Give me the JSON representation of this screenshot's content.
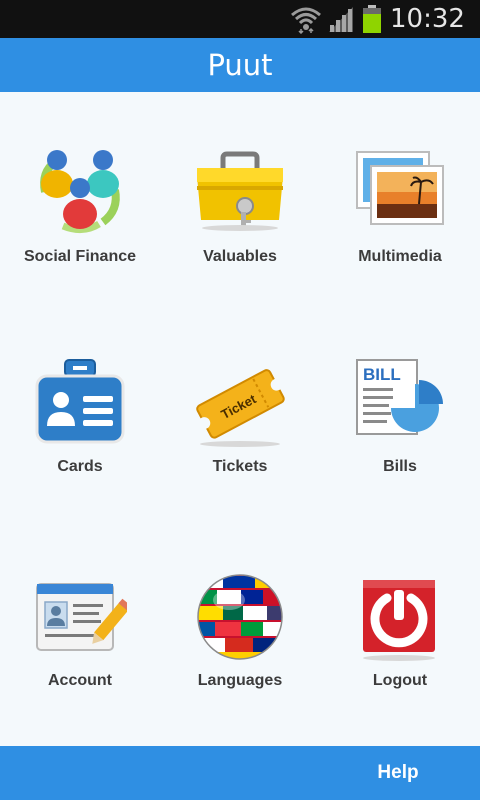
{
  "status_bar": {
    "time": "10:32"
  },
  "app": {
    "title": "Puut"
  },
  "menu": {
    "items": [
      {
        "label": "Social Finance",
        "icon": "social-finance-icon"
      },
      {
        "label": "Valuables",
        "icon": "toolbox-key-icon"
      },
      {
        "label": "Multimedia",
        "icon": "photos-icon"
      },
      {
        "label": "Cards",
        "icon": "id-card-icon"
      },
      {
        "label": "Tickets",
        "icon": "ticket-icon"
      },
      {
        "label": "Bills",
        "icon": "bill-chart-icon"
      },
      {
        "label": "Account",
        "icon": "profile-pencil-icon"
      },
      {
        "label": "Languages",
        "icon": "flag-globe-icon"
      },
      {
        "label": "Logout",
        "icon": "power-icon"
      }
    ]
  },
  "footer": {
    "help_label": "Help"
  },
  "colors": {
    "bar": "#2f8fe3",
    "status": "#111111",
    "background": "#f4f9fc",
    "label": "#3c3c3c"
  }
}
